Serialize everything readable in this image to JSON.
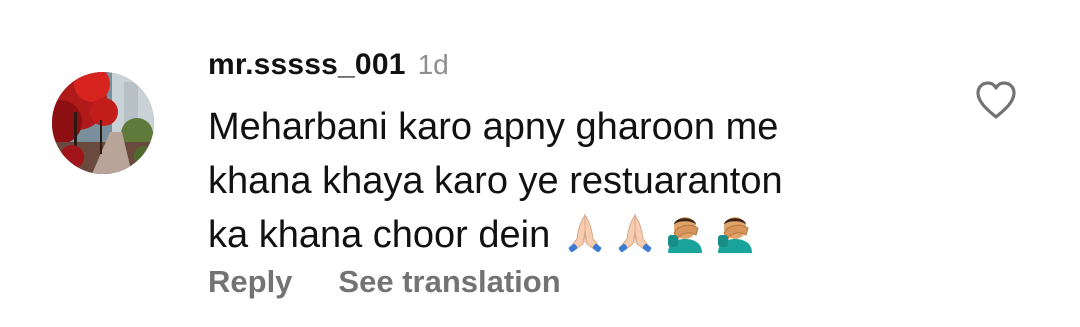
{
  "comment": {
    "username": "mr.sssss_001",
    "timestamp": "1d",
    "text_lines": [
      "Meharbani karo apny gharoon me",
      "khana khaya karo ye restuaranton",
      "ka khana choor dein"
    ],
    "emojis": [
      "folded-hands-emoji",
      "folded-hands-emoji",
      "man-facepalming-emoji",
      "man-facepalming-emoji"
    ],
    "avatar": "autumn-trees-photo",
    "actions": {
      "reply_label": "Reply",
      "translate_label": "See translation"
    },
    "like_icon": "heart-outline-icon"
  },
  "colors": {
    "text": "#111111",
    "secondary": "#8e8e8e",
    "action": "#737373"
  }
}
